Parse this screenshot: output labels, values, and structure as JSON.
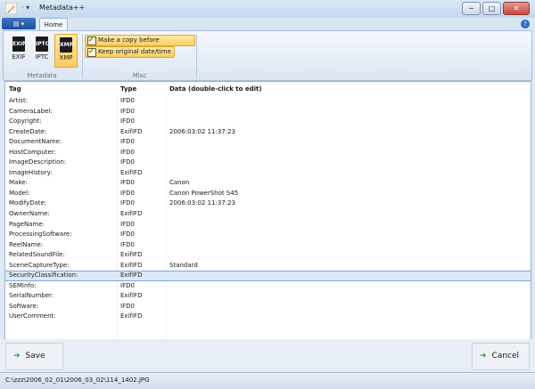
{
  "window": {
    "title": "Metadata++",
    "quick_access": "· ▾",
    "buttons": [
      "─",
      "□",
      "✕"
    ]
  },
  "ribbon": {
    "app_menu_label": "▤ ▾",
    "tabs": [
      {
        "label": "Home",
        "active": true
      }
    ],
    "help_label": "?",
    "groups": [
      {
        "name": "Metadata",
        "buttons": [
          {
            "label": "EXIF",
            "icon": "EXIF",
            "active": false
          },
          {
            "label": "IPTC",
            "icon": "IPTC",
            "active": false
          },
          {
            "label": "XMP",
            "icon": "XMP",
            "active": true
          }
        ]
      },
      {
        "name": "Misc",
        "options": [
          {
            "label": "Make a copy before modifying",
            "checked": true
          },
          {
            "label": "Keep original date/time",
            "checked": true
          }
        ]
      }
    ]
  },
  "grid": {
    "columns": [
      "Tag",
      "Type",
      "Data  (double-click to edit)"
    ],
    "rows": [
      {
        "tag": "Artist:",
        "type": "IFD0",
        "data": ""
      },
      {
        "tag": "CameraLabel:",
        "type": "IFD0",
        "data": ""
      },
      {
        "tag": "Copyright:",
        "type": "IFD0",
        "data": ""
      },
      {
        "tag": "CreateDate:",
        "type": "ExifIFD",
        "data": "2006:03:02 11:37:23"
      },
      {
        "tag": "DocumentName:",
        "type": "IFD0",
        "data": ""
      },
      {
        "tag": "HostComputer:",
        "type": "IFD0",
        "data": ""
      },
      {
        "tag": "ImageDescription:",
        "type": "IFD0",
        "data": ""
      },
      {
        "tag": "ImageHistory:",
        "type": "ExifIFD",
        "data": ""
      },
      {
        "tag": "Make:",
        "type": "IFD0",
        "data": "Canon"
      },
      {
        "tag": "Model:",
        "type": "IFD0",
        "data": "Canon PowerShot S45"
      },
      {
        "tag": "ModifyDate:",
        "type": "IFD0",
        "data": "2006:03:02 11:37:23"
      },
      {
        "tag": "OwnerName:",
        "type": "ExifIFD",
        "data": ""
      },
      {
        "tag": "PageName:",
        "type": "IFD0",
        "data": ""
      },
      {
        "tag": "ProcessingSoftware:",
        "type": "IFD0",
        "data": ""
      },
      {
        "tag": "ReelName:",
        "type": "IFD0",
        "data": ""
      },
      {
        "tag": "RelatedSoundFile:",
        "type": "ExifIFD",
        "data": ""
      },
      {
        "tag": "SceneCaptureType:",
        "type": "ExifIFD",
        "data": "Standard"
      },
      {
        "tag": "SecurityClassification:",
        "type": "ExifIFD",
        "data": "",
        "selected": true
      },
      {
        "tag": "SEMInfo:",
        "type": "IFD0",
        "data": ""
      },
      {
        "tag": "SerialNumber:",
        "type": "ExifIFD",
        "data": ""
      },
      {
        "tag": "Software:",
        "type": "IFD0",
        "data": ""
      },
      {
        "tag": "UserComment:",
        "type": "ExifIFD",
        "data": ""
      }
    ]
  },
  "actions": {
    "save_label": "Save",
    "cancel_label": "Cancel",
    "arrow_icon": "➔"
  },
  "status": {
    "path": "C:\\zzz\\2006_02_01\\2006_03_02\\114_1402.JPG"
  }
}
